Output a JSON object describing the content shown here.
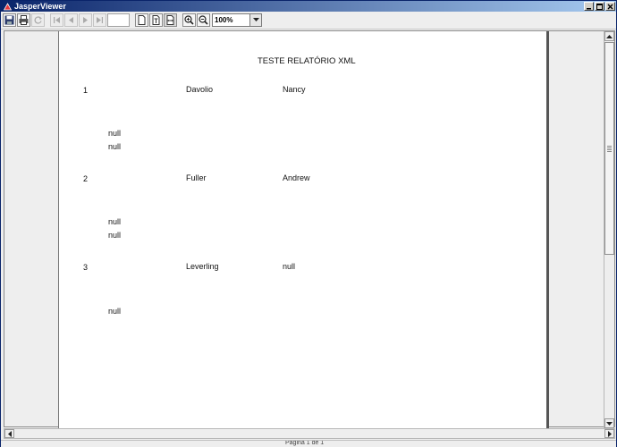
{
  "window": {
    "title": "JasperViewer"
  },
  "toolbar": {
    "page_value": "",
    "zoom_value": "100%"
  },
  "report": {
    "title": "TESTE RELATÓRIO XML",
    "records": [
      {
        "id": "1",
        "last_name": "Davolio",
        "first_name": "Nancy",
        "extra": [
          "null",
          "null"
        ]
      },
      {
        "id": "2",
        "last_name": "Fuller",
        "first_name": "Andrew",
        "extra": [
          "null",
          "null"
        ]
      },
      {
        "id": "3",
        "last_name": "Leverling",
        "first_name": "null",
        "extra": [
          "null"
        ]
      }
    ]
  },
  "status": {
    "text": "Página 1 de 1"
  }
}
